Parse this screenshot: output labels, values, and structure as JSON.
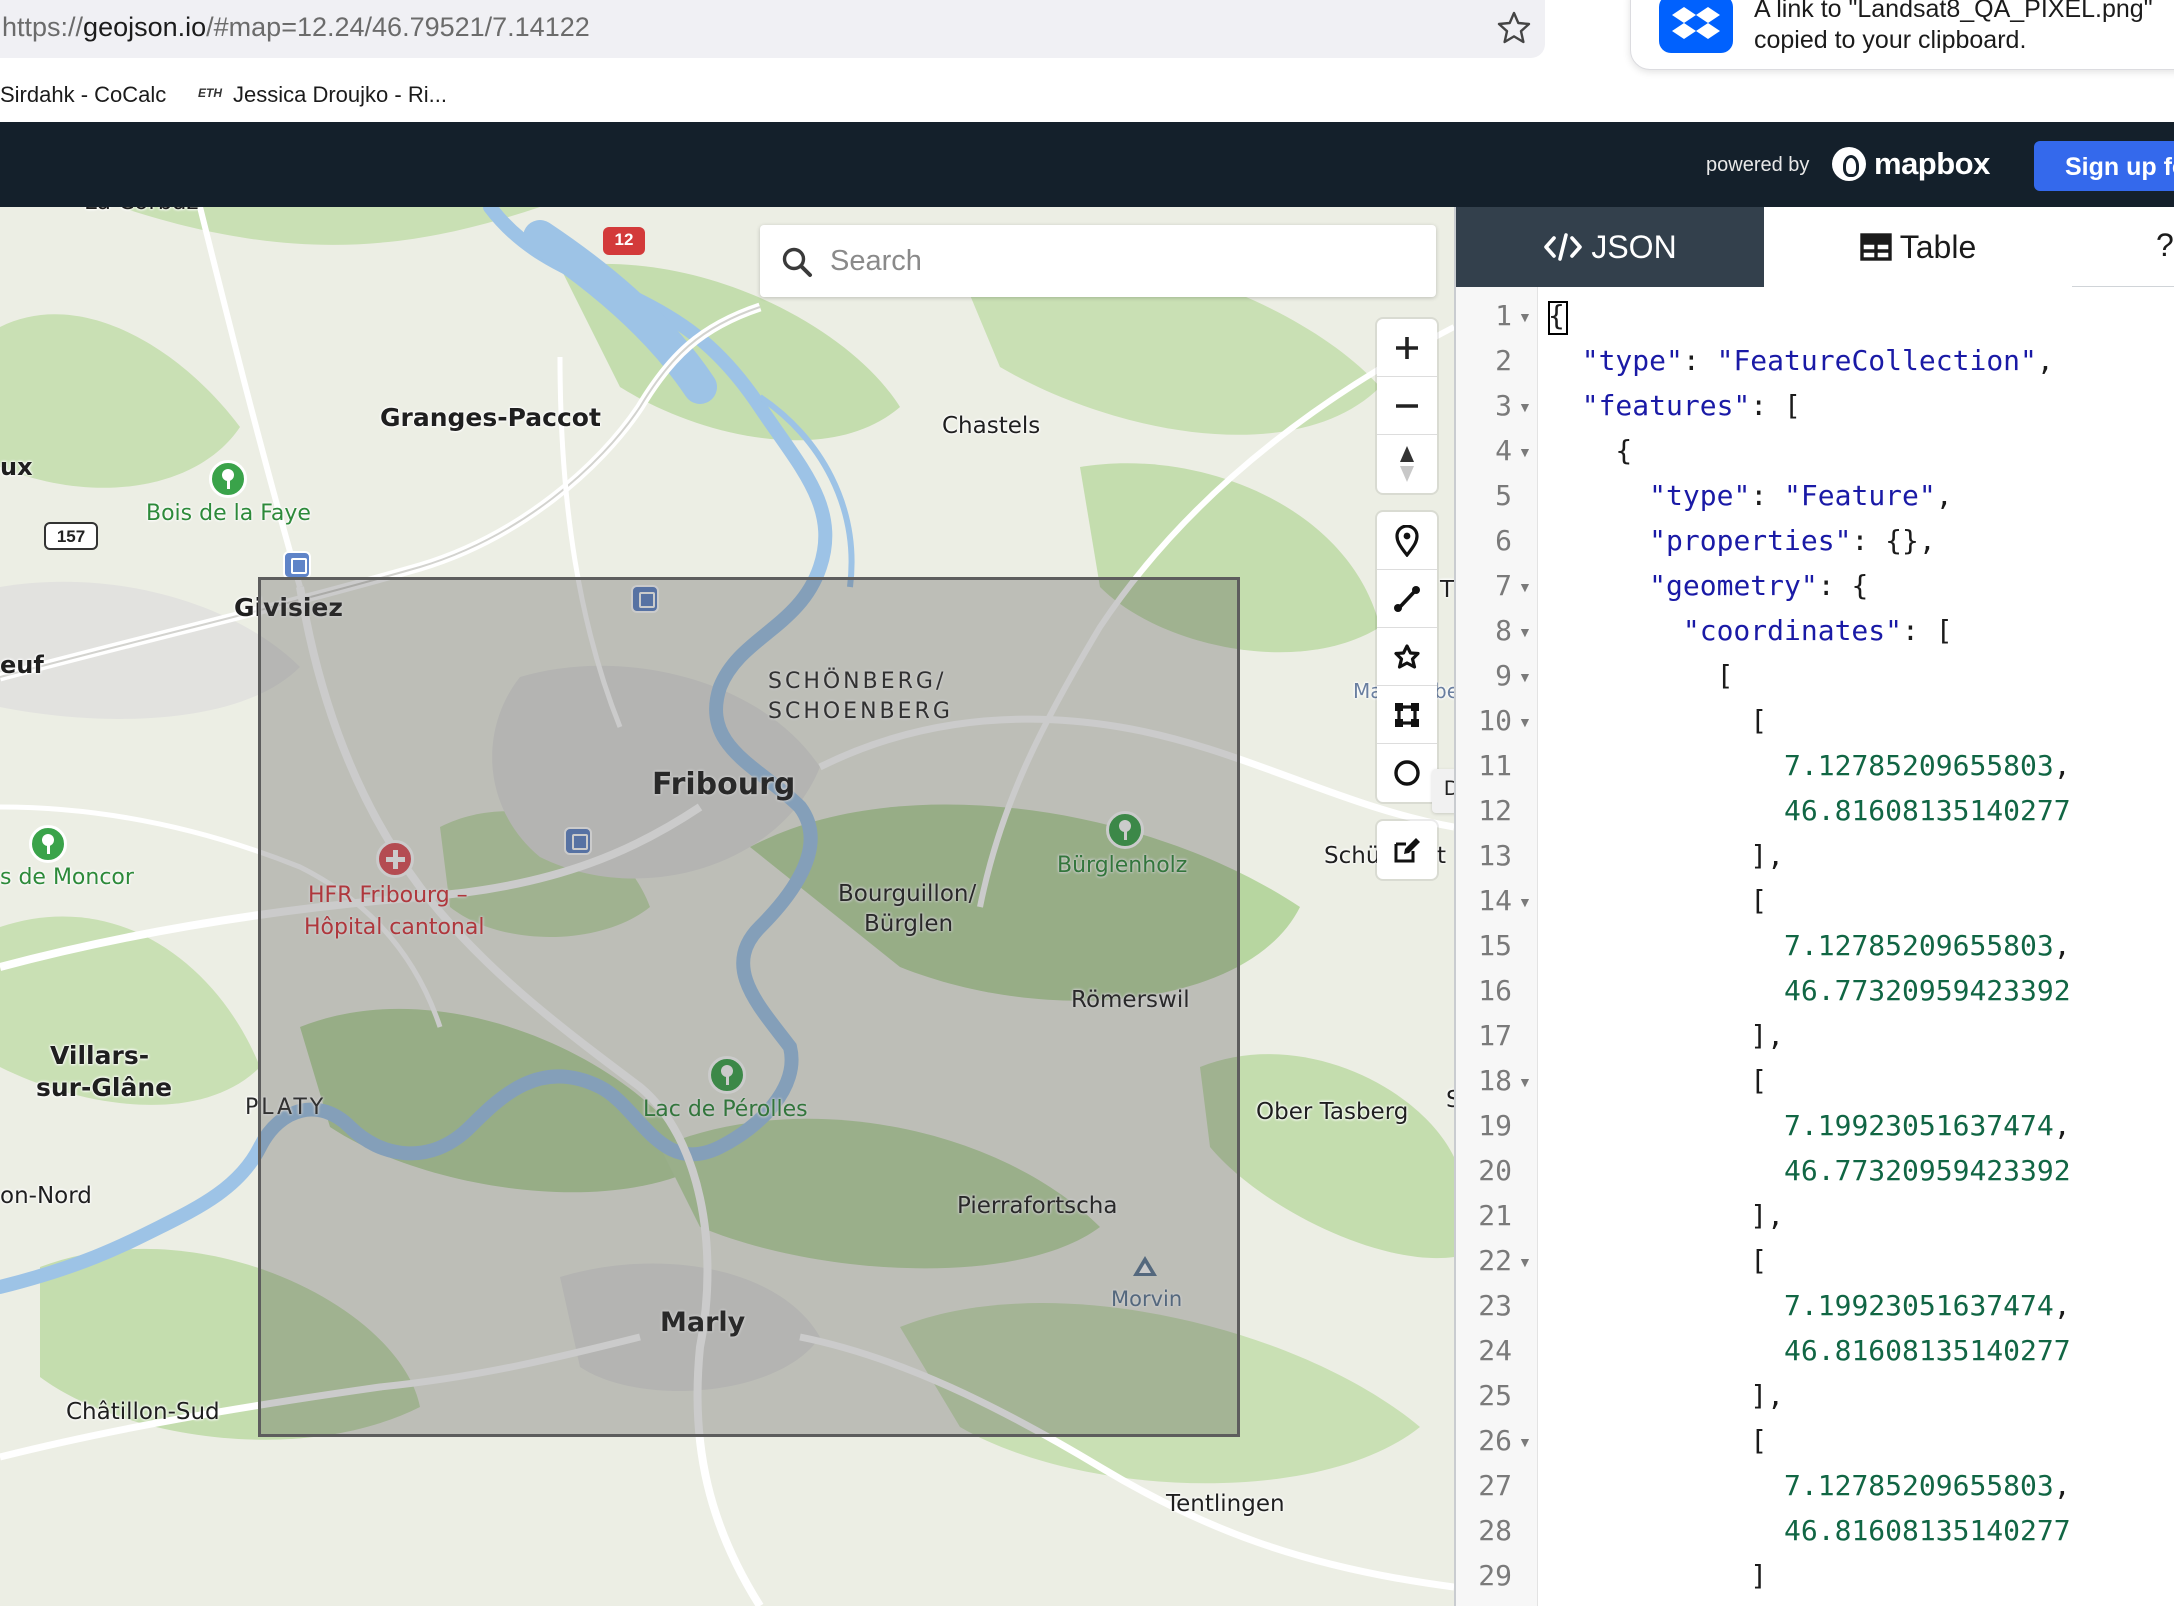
{
  "browser": {
    "url_prefix": "https://",
    "url_host": "geojson.io",
    "url_rest": "/#map=12.24/46.79521/7.14122",
    "bookmarks": [
      "Sirdahk - CoCalc",
      "Jessica Droujko - Ri..."
    ],
    "bookmark_icon_text": "ETH",
    "toast_line1": "A link to \"Landsat8_QA_PIXEL.png\"",
    "toast_line2": "copied to your clipboard."
  },
  "header": {
    "powered_by": "powered by",
    "mapbox": "mapbox",
    "signup": "Sign up for"
  },
  "map": {
    "search_placeholder": "Search",
    "tooltip": "Draw Rectangular Polygon (r)",
    "labels": {
      "la_corbaz": "La Corbaz",
      "granges": "Granges-Paccot",
      "chastels": "Chastels",
      "ux": "ux",
      "bois_faye": "Bois de la Faye",
      "givisiez": "Givisiez",
      "euf": "euf",
      "schoenberg1": "SCHÖNBERG/",
      "schoenberg2": "SCHOENBERG",
      "fribourg": "Fribourg",
      "moncor": "s de Moncor",
      "hfr1": "HFR Fribourg –",
      "hfr2": "Hôpital cantonal",
      "burglenholz": "Bürglenholz",
      "bourguillon1": "Bourguillon/",
      "bourguillon2": "Bürglen",
      "schue": "Schü",
      "roemerswil": "Römerswil",
      "villars1": "Villars-",
      "villars2": "sur-Glâne",
      "platy": "PLATY",
      "lac_perolles": "Lac de Pérolles",
      "ober_tasberg": "Ober Tasberg",
      "on_nord": "on-Nord",
      "pierrafortscha": "Pierrafortscha",
      "morvin": "Morvin",
      "marly": "Marly",
      "chatillon": "Châtillon-Sud",
      "tentlingen": "Tentlingen",
      "t_edge": "T",
      "ma_edge": "Ma",
      "be_edge": "be",
      "t2_edge": "t",
      "s_edge": "S"
    },
    "shields": {
      "road12": "12",
      "road157": "157"
    }
  },
  "panel": {
    "tab_json": "JSON",
    "tab_table": "Table",
    "tab_help": "?",
    "lines": [
      {
        "n": "1",
        "fold": true,
        "text": "{"
      },
      {
        "n": "2",
        "fold": false,
        "text": "  \"type\": \"FeatureCollection\","
      },
      {
        "n": "3",
        "fold": true,
        "text": "  \"features\": ["
      },
      {
        "n": "4",
        "fold": true,
        "text": "    {"
      },
      {
        "n": "5",
        "fold": false,
        "text": "      \"type\": \"Feature\","
      },
      {
        "n": "6",
        "fold": false,
        "text": "      \"properties\": {},"
      },
      {
        "n": "7",
        "fold": true,
        "text": "      \"geometry\": {"
      },
      {
        "n": "8",
        "fold": true,
        "text": "        \"coordinates\": ["
      },
      {
        "n": "9",
        "fold": true,
        "text": "          ["
      },
      {
        "n": "10",
        "fold": true,
        "text": "            ["
      },
      {
        "n": "11",
        "fold": false,
        "text": "              7.12785209655803,"
      },
      {
        "n": "12",
        "fold": false,
        "text": "              46.81608135140277"
      },
      {
        "n": "13",
        "fold": false,
        "text": "            ],"
      },
      {
        "n": "14",
        "fold": true,
        "text": "            ["
      },
      {
        "n": "15",
        "fold": false,
        "text": "              7.12785209655803,"
      },
      {
        "n": "16",
        "fold": false,
        "text": "              46.77320959423392"
      },
      {
        "n": "17",
        "fold": false,
        "text": "            ],"
      },
      {
        "n": "18",
        "fold": true,
        "text": "            ["
      },
      {
        "n": "19",
        "fold": false,
        "text": "              7.19923051637474,"
      },
      {
        "n": "20",
        "fold": false,
        "text": "              46.77320959423392"
      },
      {
        "n": "21",
        "fold": false,
        "text": "            ],"
      },
      {
        "n": "22",
        "fold": true,
        "text": "            ["
      },
      {
        "n": "23",
        "fold": false,
        "text": "              7.19923051637474,"
      },
      {
        "n": "24",
        "fold": false,
        "text": "              46.81608135140277"
      },
      {
        "n": "25",
        "fold": false,
        "text": "            ],"
      },
      {
        "n": "26",
        "fold": true,
        "text": "            ["
      },
      {
        "n": "27",
        "fold": false,
        "text": "              7.12785209655803,"
      },
      {
        "n": "28",
        "fold": false,
        "text": "              46.81608135140277"
      },
      {
        "n": "29",
        "fold": false,
        "text": "            ]"
      }
    ]
  },
  "colors": {
    "appbar": "#14202b",
    "signup": "#3469ec",
    "json_tab": "#33404c",
    "water": "#9dc3e6",
    "forest": "#b9d9a4",
    "rect_fill": "#464646",
    "rect_stroke": "#5d5d5d"
  }
}
